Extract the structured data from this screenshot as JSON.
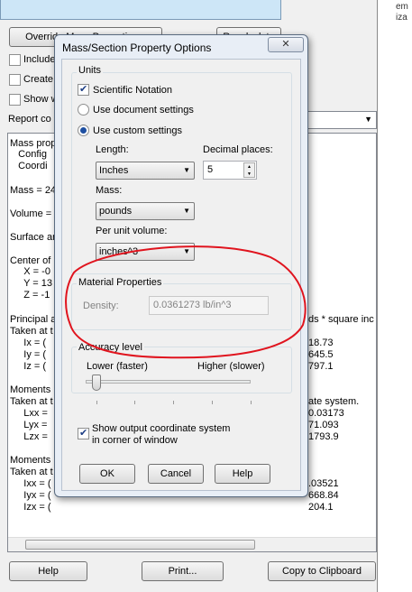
{
  "background": {
    "override_button": "Override Mass Properties...",
    "recalculate_button": "Recalculate",
    "include_hidden": "Include",
    "create_cog": "Create",
    "show_weld": "Show w",
    "report_label": "Report co",
    "right_strip": [
      "em",
      "iza"
    ],
    "results_lines": [
      "Mass prop",
      "   Config",
      "   Coordi",
      "Mass = 24",
      "Volume =",
      "Surface ar",
      "Center of",
      "     X = -0",
      "     Y = 13",
      "     Z = -1",
      "Principal a",
      "Taken at t",
      "     Ix = (",
      "     Iy = (",
      "     Iz = (",
      "Moments",
      "Taken at t",
      "     Lxx =",
      "     Lyx =",
      "     Lzx =",
      "Moments",
      "Taken at t",
      "     Ixx = (",
      "     Iyx = (",
      "     Izx = (",
      "ds * square inc",
      "18.73",
      "645.5",
      "797.1",
      "ate system.",
      "0.03173",
      "71.093",
      "1793.9",
      ".03521",
      "668.84",
      "204.1"
    ],
    "help_button": "Help",
    "print_button": "Print...",
    "copy_button": "Copy to Clipboard"
  },
  "dialog": {
    "title": "Mass/Section Property Options",
    "close_label": "✕",
    "units_group": "Units",
    "scientific_notation": "Scientific Notation",
    "scientific_checked": true,
    "use_document": "Use document settings",
    "use_custom": "Use custom settings",
    "length_label": "Length:",
    "length_value": "Inches",
    "decimal_label": "Decimal places:",
    "decimal_value": "5",
    "mass_label": "Mass:",
    "mass_value": "pounds",
    "per_volume_label": "Per unit volume:",
    "per_volume_value": "inches^3",
    "material_group": "Material Properties",
    "density_label": "Density:",
    "density_value": "0.0361273 lb/in^3",
    "accuracy_group": "Accuracy level",
    "lower_label": "Lower (faster)",
    "higher_label": "Higher (slower)",
    "accuracy_level_fraction": 0.05,
    "show_output_line1": "Show output coordinate system",
    "show_output_line2": "in corner of window",
    "show_output_checked": true,
    "ok": "OK",
    "cancel": "Cancel",
    "help": "Help"
  },
  "annotation_color": "#e0141e"
}
